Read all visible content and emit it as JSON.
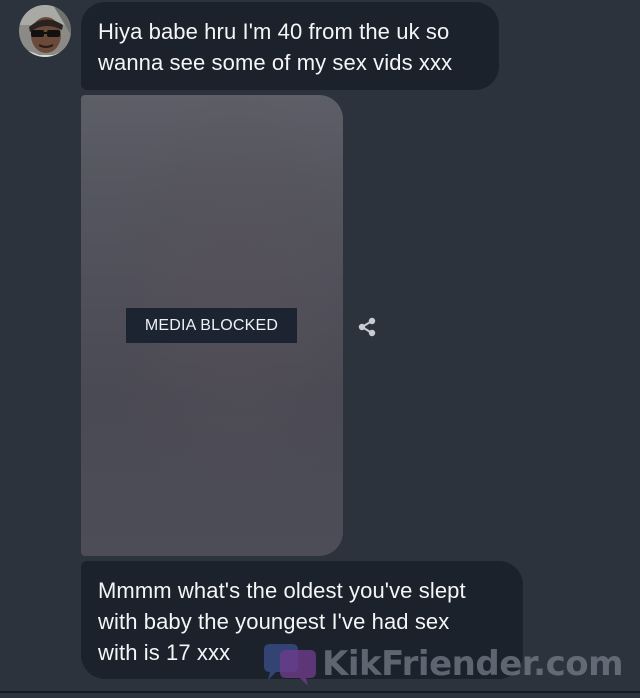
{
  "messages": [
    {
      "sender": "other",
      "text_line1": "Hiya babe hru I'm 40 from the uk so",
      "text_line2": "wanna see some of my sex vids xxx"
    },
    {
      "sender": "other",
      "type": "media",
      "status_label": "MEDIA BLOCKED"
    },
    {
      "sender": "other",
      "text_line1": "Mmmm what's the oldest you've slept",
      "text_line2": "with baby the youngest I've had sex",
      "text_line3": "with is 17 xxx"
    }
  ],
  "icons": {
    "share": "share-icon",
    "watermark_logo": "chat-bubbles-logo-icon"
  },
  "watermark": {
    "text": "KikFriender.com"
  },
  "colors": {
    "background": "#2c333c",
    "bubble": "#1b222c",
    "bubble_text": "#f3f5f7",
    "media_label_bg": "#1c2431"
  }
}
